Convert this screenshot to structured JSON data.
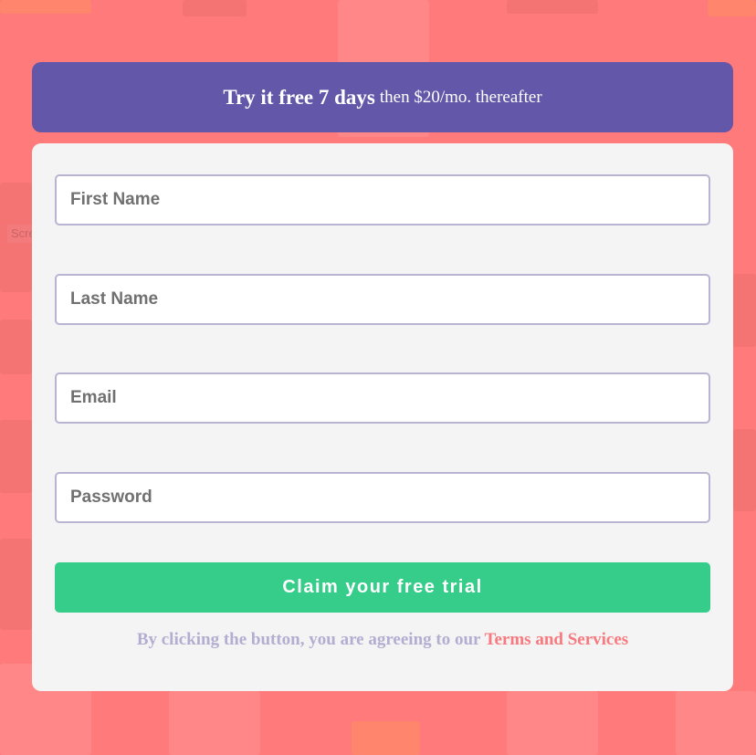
{
  "banner": {
    "headline": "Try it free 7 days",
    "subline": "then $20/mo. thereafter"
  },
  "form": {
    "first_name_placeholder": "First Name",
    "last_name_placeholder": "Last Name",
    "email_placeholder": "Email",
    "password_placeholder": "Password",
    "submit_label": "Claim your free trial"
  },
  "legal": {
    "text": "By clicking the button, you are agreeing to our",
    "link_label": "Terms and Services"
  },
  "background": {
    "ghost_text": "Screen Snip"
  },
  "colors": {
    "background": "#ff7a7a",
    "banner": "#6257a8",
    "card": "#f4f4f4",
    "button": "#36cc8a",
    "link": "#f87a7e",
    "legal_text": "#b3aed1",
    "input_border": "#b9b4d2"
  }
}
